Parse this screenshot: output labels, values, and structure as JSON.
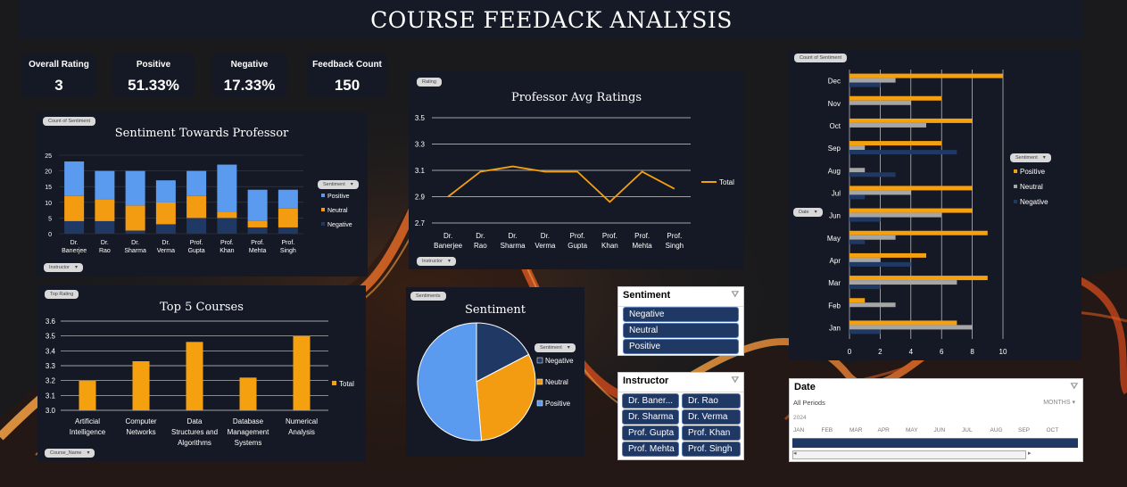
{
  "title": "COURSE FEEDACK ANALYSIS",
  "kpis": [
    {
      "label": "Overall Rating",
      "value": "3"
    },
    {
      "label": "Positive",
      "value": "51.33%"
    },
    {
      "label": "Negative",
      "value": "17.33%"
    },
    {
      "label": "Feedback Count",
      "value": "150"
    }
  ],
  "colors": {
    "positive": "#5b9bef",
    "neutral": "#f39c12",
    "negative": "#1f3864",
    "gray": "#a6a6a6",
    "orange": "#f5a00f"
  },
  "chips": {
    "count_of_sentiment": "Count of Sentiment",
    "sentiment": "Sentiment",
    "instructor": "Instructor",
    "rating": "Rating",
    "top_rating": "Top Rating",
    "sentiments": "Sentiments",
    "course_name": "Course_Name",
    "date": "Date"
  },
  "chart_data": [
    {
      "type": "bar",
      "stacked": true,
      "title": "Sentiment Towards Professor",
      "categories": [
        "Dr. Banerjee",
        "Dr. Rao",
        "Dr. Sharma",
        "Dr. Verma",
        "Prof. Gupta",
        "Prof. Khan",
        "Prof. Mehta",
        "Prof. Singh"
      ],
      "series": [
        {
          "name": "Negative",
          "values": [
            4,
            4,
            1,
            3,
            5,
            5,
            2,
            2
          ]
        },
        {
          "name": "Neutral",
          "values": [
            8,
            7,
            8,
            7,
            7,
            2,
            2,
            6
          ]
        },
        {
          "name": "Positive",
          "values": [
            11,
            9,
            11,
            7,
            8,
            15,
            10,
            6
          ]
        }
      ],
      "ylim": [
        0,
        25
      ],
      "yticks": [
        "0",
        "5",
        "10",
        "15",
        "20",
        "25"
      ],
      "legend": "right"
    },
    {
      "type": "line",
      "title": "Professor Avg Ratings",
      "categories": [
        "Dr. Banerjee",
        "Dr. Rao",
        "Dr. Sharma",
        "Dr. Verma",
        "Prof. Gupta",
        "Prof. Khan",
        "Prof. Mehta",
        "Prof. Singh"
      ],
      "series": [
        {
          "name": "Total",
          "values": [
            2.9,
            3.09,
            3.13,
            3.09,
            3.09,
            2.86,
            3.09,
            2.96
          ]
        }
      ],
      "ylim": [
        2.7,
        3.5
      ],
      "yticks": [
        "2.7",
        "2.9",
        "3.1",
        "3.3",
        "3.5"
      ],
      "legend": "right"
    },
    {
      "type": "bar",
      "title": "Top 5 Courses",
      "categories": [
        "Artificial Intelligence",
        "Computer Networks",
        "Data Structures and Algorithms",
        "Database Management Systems",
        "Numerical Analysis"
      ],
      "series": [
        {
          "name": "Total",
          "values": [
            3.2,
            3.33,
            3.46,
            3.22,
            3.5
          ]
        }
      ],
      "ylim": [
        3.0,
        3.6
      ],
      "yticks": [
        "3.0",
        "3.1",
        "3.2",
        "3.3",
        "3.4",
        "3.5",
        "3.6"
      ],
      "legend": "right"
    },
    {
      "type": "pie",
      "title": "Sentiment",
      "series": [
        {
          "name": "Sentiment",
          "labels": [
            "Negative",
            "Neutral",
            "Positive"
          ],
          "values": [
            17.33,
            31.33,
            51.33
          ]
        }
      ],
      "legend": "right"
    },
    {
      "type": "bar",
      "orientation": "horizontal",
      "categories": [
        "Jan",
        "Feb",
        "Mar",
        "Apr",
        "May",
        "Jun",
        "Jul",
        "Aug",
        "Sep",
        "Oct",
        "Nov",
        "Dec"
      ],
      "series": [
        {
          "name": "Positive",
          "values": [
            7,
            1,
            9,
            5,
            9,
            8,
            8,
            0,
            6,
            8,
            6,
            10
          ]
        },
        {
          "name": "Neutral",
          "values": [
            8,
            3,
            7,
            2,
            3,
            6,
            4,
            1,
            1,
            5,
            4,
            3
          ]
        },
        {
          "name": "Negative",
          "values": [
            2,
            0,
            2,
            4,
            1,
            2,
            1,
            3,
            7,
            0,
            0,
            2
          ]
        }
      ],
      "xlim": [
        0,
        10
      ],
      "xticks": [
        "0",
        "2",
        "4",
        "6",
        "8",
        "10"
      ],
      "legend": "right"
    }
  ],
  "slicers": {
    "sentiment": {
      "title": "Sentiment",
      "items": [
        "Negative",
        "Neutral",
        "Positive"
      ]
    },
    "instructor": {
      "title": "Instructor",
      "items": [
        "Dr. Baner...",
        "Dr. Rao",
        "Dr. Sharma",
        "Dr. Verma",
        "Prof. Gupta",
        "Prof. Khan",
        "Prof. Mehta",
        "Prof. Singh"
      ]
    },
    "date": {
      "title": "Date",
      "period": "All Periods",
      "level": "MONTHS",
      "year": "2024",
      "months": [
        "JAN",
        "FEB",
        "MAR",
        "APR",
        "MAY",
        "JUN",
        "JUL",
        "AUG",
        "SEP",
        "OCT"
      ]
    }
  }
}
